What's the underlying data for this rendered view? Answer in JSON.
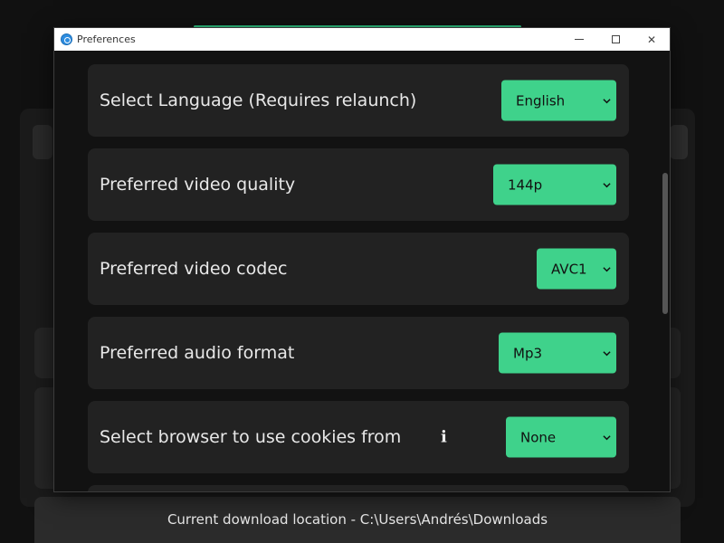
{
  "window": {
    "title": "Preferences",
    "controls": {
      "minimize": "minimize",
      "maximize": "maximize",
      "close": "✕"
    }
  },
  "settings": [
    {
      "label": "Select Language (Requires relaunch)",
      "value": "English"
    },
    {
      "label": "Preferred video quality",
      "value": "144p"
    },
    {
      "label": "Preferred video codec",
      "value": "AVC1"
    },
    {
      "label": "Preferred audio format",
      "value": "Mp3"
    },
    {
      "label": "Select browser to use cookies from",
      "value": "None",
      "info": "i"
    }
  ],
  "footer": {
    "download_location": "Current download location - C:\\Users\\Andrés\\Downloads"
  },
  "colors": {
    "accent": "#3fd28b",
    "row_bg": "#222222",
    "window_bg": "#121212"
  },
  "icons": [
    "app-icon",
    "minimize-icon",
    "maximize-icon",
    "close-icon",
    "chevron-down-icon",
    "info-icon"
  ]
}
